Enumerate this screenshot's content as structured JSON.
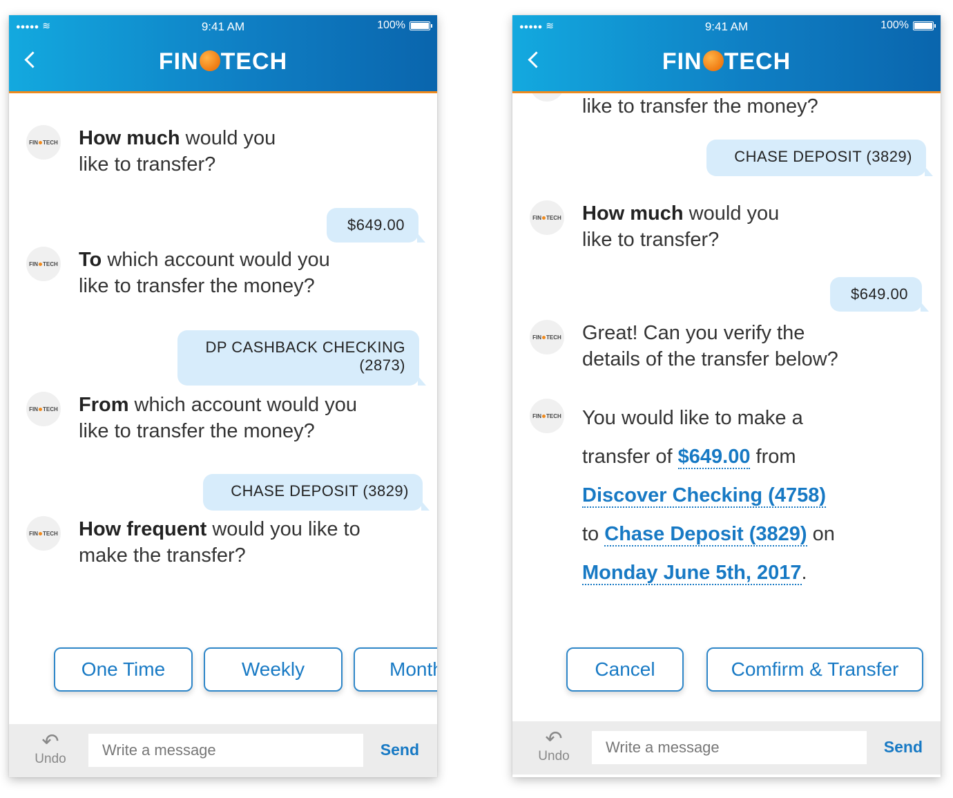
{
  "status_bar": {
    "signal": "●●●●●",
    "wifi": "≋",
    "time": "9:41 AM",
    "battery": "100%"
  },
  "brand": {
    "part1": "FIN",
    "part2": "TECH"
  },
  "avatar": {
    "part1": "FIN",
    "part2": "TECH"
  },
  "left": {
    "messages": [
      {
        "bold": "How much",
        "rest": " would you",
        "line2": "like to transfer?"
      },
      {
        "bold": "To",
        "rest": " which account would you",
        "line2": "like to transfer the money?"
      },
      {
        "bold": "From",
        "rest": " which account would you",
        "line2": "like to transfer the money?"
      },
      {
        "bold": "How frequent",
        "rest": " would you like to",
        "line2": "make the transfer?"
      }
    ],
    "replies": [
      {
        "line1": "$649.00"
      },
      {
        "line1": "DP CASHBACK CHECKING",
        "line2": "(2873)"
      },
      {
        "line1": "CHASE DEPOSIT (3829)"
      }
    ],
    "options": [
      "One Time",
      "Weekly",
      "Monthly"
    ]
  },
  "right": {
    "partial_message": "like to transfer the money?",
    "replies": [
      {
        "line1": "CHASE DEPOSIT (3829)"
      },
      {
        "line1": "$649.00"
      }
    ],
    "messages": [
      {
        "bold": "How much",
        "rest": " would you",
        "line2": "like to transfer?"
      },
      {
        "line1": "Great! Can you verify the",
        "line2": "details of the transfer below?"
      }
    ],
    "summary": {
      "text1": "You would like to make a",
      "text2": "transfer of ",
      "amount": "$649.00",
      "text3": " from",
      "from_account": "Discover Checking (4758)",
      "text4": "to ",
      "to_account": "Chase Deposit (3829)",
      "text5": " on",
      "date": "Monday June 5th, 2017",
      "text6": "."
    },
    "actions": {
      "cancel": "Cancel",
      "confirm": "Comfirm & Transfer"
    }
  },
  "composer": {
    "undo": "Undo",
    "placeholder": "Write a message",
    "send": "Send"
  }
}
